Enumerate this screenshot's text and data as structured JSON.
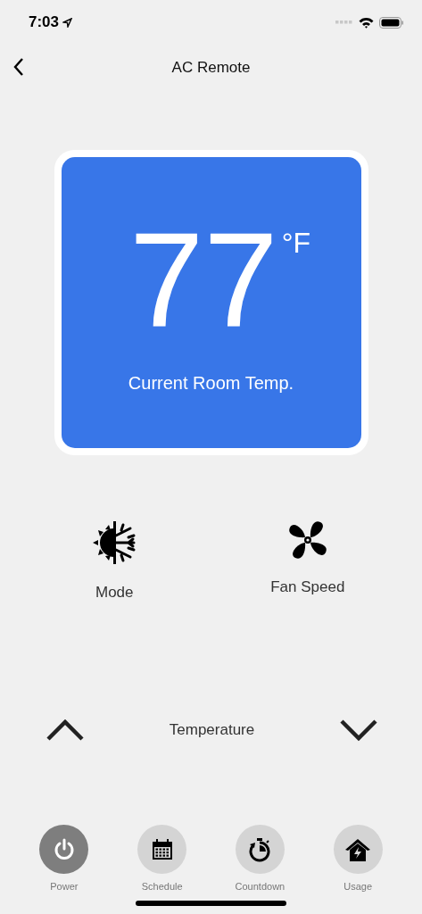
{
  "status_bar": {
    "time": "7:03"
  },
  "nav": {
    "title": "AC Remote"
  },
  "display": {
    "temperature": "77",
    "unit": "°F",
    "caption": "Current Room Temp."
  },
  "controls": [
    {
      "kind": "mode",
      "label": "Mode"
    },
    {
      "kind": "fan",
      "label": "Fan Speed"
    }
  ],
  "temperature": {
    "label": "Temperature"
  },
  "actions": [
    {
      "kind": "power",
      "label": "Power",
      "active": true
    },
    {
      "kind": "schedule",
      "label": "Schedule",
      "active": false
    },
    {
      "kind": "countdown",
      "label": "Countdown",
      "active": false
    },
    {
      "kind": "usage",
      "label": "Usage",
      "active": false
    }
  ]
}
